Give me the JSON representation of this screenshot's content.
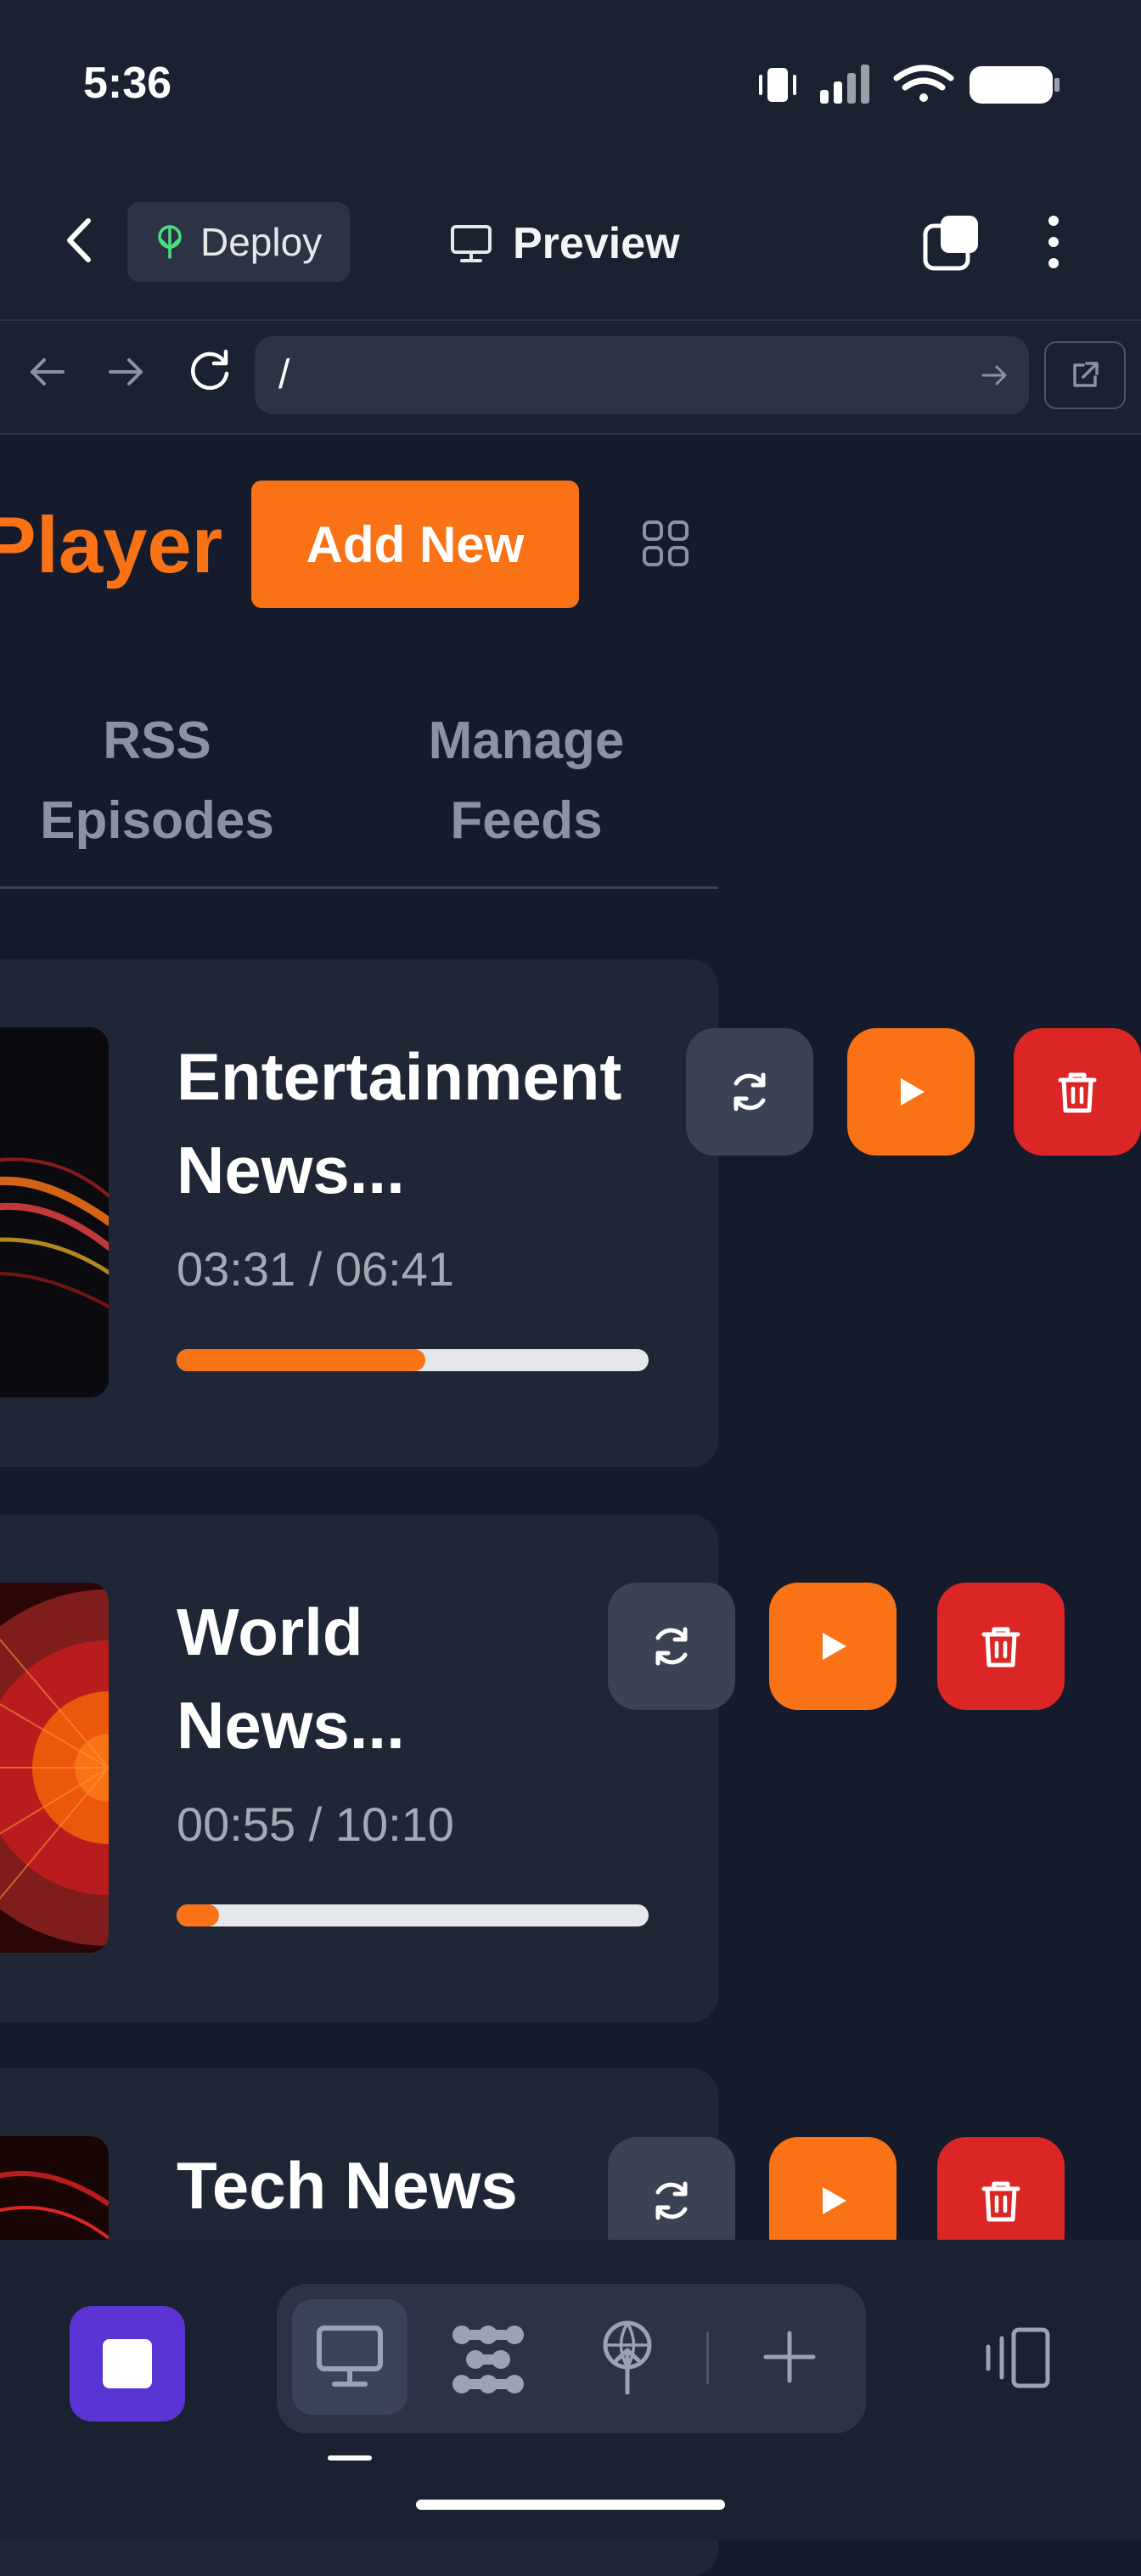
{
  "status_bar": {
    "time": "5:36"
  },
  "toolbar": {
    "deploy_label": "Deploy",
    "preview_label": "Preview"
  },
  "browser": {
    "url": "/"
  },
  "app": {
    "brand_visible": "Player",
    "add_button": "Add New"
  },
  "tabs": [
    {
      "label_line1": "RSS",
      "label_line2": "Episodes"
    },
    {
      "label_line1": "Manage",
      "label_line2": "Feeds"
    }
  ],
  "episodes": [
    {
      "title_line1": "Entertainment",
      "title_line2": "News...",
      "time": "03:31 / 06:41",
      "progress": 0.527
    },
    {
      "title_line1": "World",
      "title_line2": "News...",
      "time": "00:55 / 10:10",
      "progress": 0.09
    },
    {
      "title_line1": "Tech News",
      "title_line2": "",
      "time": "",
      "progress": 0
    }
  ],
  "colors": {
    "accent": "#f97316",
    "danger": "#dc2626",
    "background": "#151b2b",
    "card": "#1f2737",
    "stop": "#5a35d4"
  },
  "icons": [
    "back-icon",
    "deploy-icon",
    "monitor-icon",
    "tabs-icon",
    "more-icon",
    "arrow-left-icon",
    "arrow-right-icon",
    "reload-icon",
    "go-icon",
    "external-link-icon",
    "grid-icon",
    "refresh-icon",
    "play-icon",
    "trash-icon",
    "stop-icon",
    "plugins-icon",
    "add-icon",
    "device-icon"
  ]
}
